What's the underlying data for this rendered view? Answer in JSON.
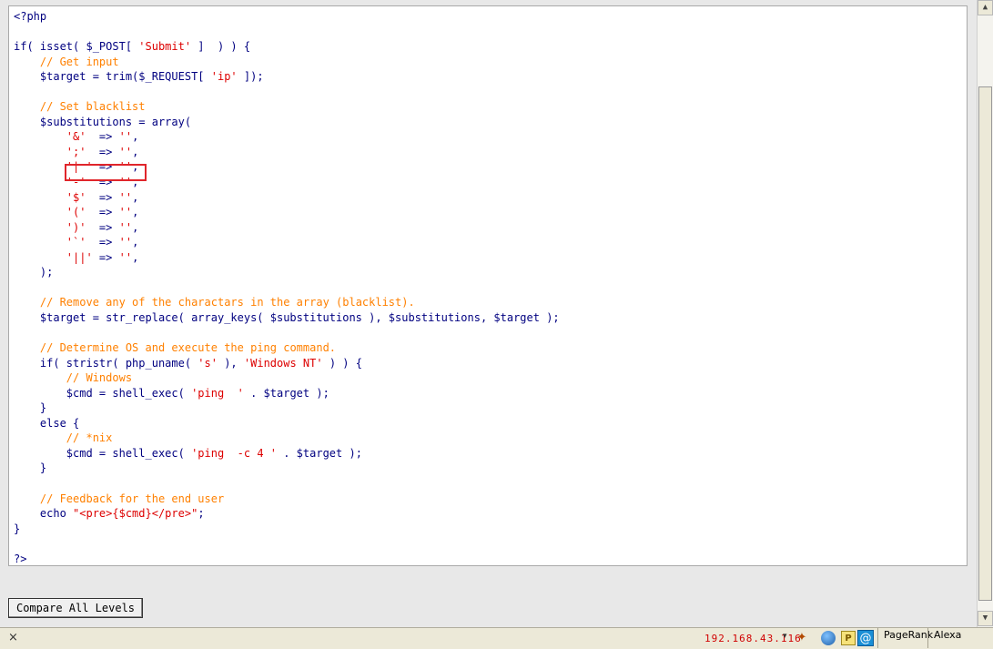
{
  "code_lines": [
    [
      {
        "t": "<?php",
        "c": "kw"
      }
    ],
    [],
    [
      {
        "t": "if( isset( $_POST[ ",
        "c": "kw"
      },
      {
        "t": "'Submit'",
        "c": "st"
      },
      {
        "t": " ]  ) ) {",
        "c": "kw"
      }
    ],
    [
      {
        "t": "    "
      },
      {
        "t": "// Get input",
        "c": "cm"
      }
    ],
    [
      {
        "t": "    $target = trim($_REQUEST[ ",
        "c": "kw"
      },
      {
        "t": "'ip'",
        "c": "st"
      },
      {
        "t": " ]);",
        "c": "kw"
      }
    ],
    [],
    [
      {
        "t": "    "
      },
      {
        "t": "// Set blacklist",
        "c": "cm"
      }
    ],
    [
      {
        "t": "    $substitutions = array(",
        "c": "kw"
      }
    ],
    [
      {
        "t": "        "
      },
      {
        "t": "'&'",
        "c": "st"
      },
      {
        "t": "  => ",
        "c": "kw"
      },
      {
        "t": "''",
        "c": "st"
      },
      {
        "t": ",",
        "c": "kw"
      }
    ],
    [
      {
        "t": "        "
      },
      {
        "t": "';'",
        "c": "st"
      },
      {
        "t": "  => ",
        "c": "kw"
      },
      {
        "t": "''",
        "c": "st"
      },
      {
        "t": ",",
        "c": "kw"
      }
    ],
    [
      {
        "t": "        "
      },
      {
        "t": "'| '",
        "c": "st"
      },
      {
        "t": " => ",
        "c": "kw"
      },
      {
        "t": "''",
        "c": "st"
      },
      {
        "t": ",",
        "c": "kw"
      }
    ],
    [
      {
        "t": "        "
      },
      {
        "t": "'-'",
        "c": "st"
      },
      {
        "t": "  => ",
        "c": "kw"
      },
      {
        "t": "''",
        "c": "st"
      },
      {
        "t": ",",
        "c": "kw"
      }
    ],
    [
      {
        "t": "        "
      },
      {
        "t": "'$'",
        "c": "st"
      },
      {
        "t": "  => ",
        "c": "kw"
      },
      {
        "t": "''",
        "c": "st"
      },
      {
        "t": ",",
        "c": "kw"
      }
    ],
    [
      {
        "t": "        "
      },
      {
        "t": "'('",
        "c": "st"
      },
      {
        "t": "  => ",
        "c": "kw"
      },
      {
        "t": "''",
        "c": "st"
      },
      {
        "t": ",",
        "c": "kw"
      }
    ],
    [
      {
        "t": "        "
      },
      {
        "t": "')'",
        "c": "st"
      },
      {
        "t": "  => ",
        "c": "kw"
      },
      {
        "t": "''",
        "c": "st"
      },
      {
        "t": ",",
        "c": "kw"
      }
    ],
    [
      {
        "t": "        "
      },
      {
        "t": "'`'",
        "c": "st"
      },
      {
        "t": "  => ",
        "c": "kw"
      },
      {
        "t": "''",
        "c": "st"
      },
      {
        "t": ",",
        "c": "kw"
      }
    ],
    [
      {
        "t": "        "
      },
      {
        "t": "'||'",
        "c": "st"
      },
      {
        "t": " => ",
        "c": "kw"
      },
      {
        "t": "''",
        "c": "st"
      },
      {
        "t": ",",
        "c": "kw"
      }
    ],
    [
      {
        "t": "    );",
        "c": "kw"
      }
    ],
    [],
    [
      {
        "t": "    "
      },
      {
        "t": "// Remove any of the charactars in the array (blacklist).",
        "c": "cm"
      }
    ],
    [
      {
        "t": "    $target = str_replace( array_keys( $substitutions ), $substitutions, $target );",
        "c": "kw"
      }
    ],
    [],
    [
      {
        "t": "    "
      },
      {
        "t": "// Determine OS and execute the ping command.",
        "c": "cm"
      }
    ],
    [
      {
        "t": "    if( stristr( php_uname( ",
        "c": "kw"
      },
      {
        "t": "'s'",
        "c": "st"
      },
      {
        "t": " ), ",
        "c": "kw"
      },
      {
        "t": "'Windows NT'",
        "c": "st"
      },
      {
        "t": " ) ) {",
        "c": "kw"
      }
    ],
    [
      {
        "t": "        "
      },
      {
        "t": "// Windows",
        "c": "cm"
      }
    ],
    [
      {
        "t": "        $cmd = shell_exec( ",
        "c": "kw"
      },
      {
        "t": "'ping  '",
        "c": "st"
      },
      {
        "t": " . $target );",
        "c": "kw"
      }
    ],
    [
      {
        "t": "    }",
        "c": "kw"
      }
    ],
    [
      {
        "t": "    else {",
        "c": "kw"
      }
    ],
    [
      {
        "t": "        "
      },
      {
        "t": "// *nix",
        "c": "cm"
      }
    ],
    [
      {
        "t": "        $cmd = shell_exec( ",
        "c": "kw"
      },
      {
        "t": "'ping  -c 4 '",
        "c": "st"
      },
      {
        "t": " . $target );",
        "c": "kw"
      }
    ],
    [
      {
        "t": "    }",
        "c": "kw"
      }
    ],
    [],
    [
      {
        "t": "    "
      },
      {
        "t": "// Feedback for the end user",
        "c": "cm"
      }
    ],
    [
      {
        "t": "    echo ",
        "c": "kw"
      },
      {
        "t": "\"<pre>{$cmd}</pre>\"",
        "c": "st"
      },
      {
        "t": ";",
        "c": "kw"
      }
    ],
    [
      {
        "t": "}",
        "c": "kw"
      }
    ],
    [],
    [
      {
        "t": "?>",
        "c": "kw"
      }
    ]
  ],
  "buttons": {
    "compare_all_levels": "Compare All Levels"
  },
  "statusbar": {
    "close_glyph": "×",
    "ip": "192.168.43.116",
    "pagerank_label": "PageRank",
    "alexa_label": "Alexa"
  },
  "colors": {
    "keyword": "#000080",
    "comment": "#ff8000",
    "string": "#dd0000",
    "highlight_border": "#e0252b",
    "ip_text": "#d00000"
  },
  "icons": [
    "firefox-extension-icon",
    "globe-icon",
    "pdf-icon",
    "at-sign-icon"
  ]
}
